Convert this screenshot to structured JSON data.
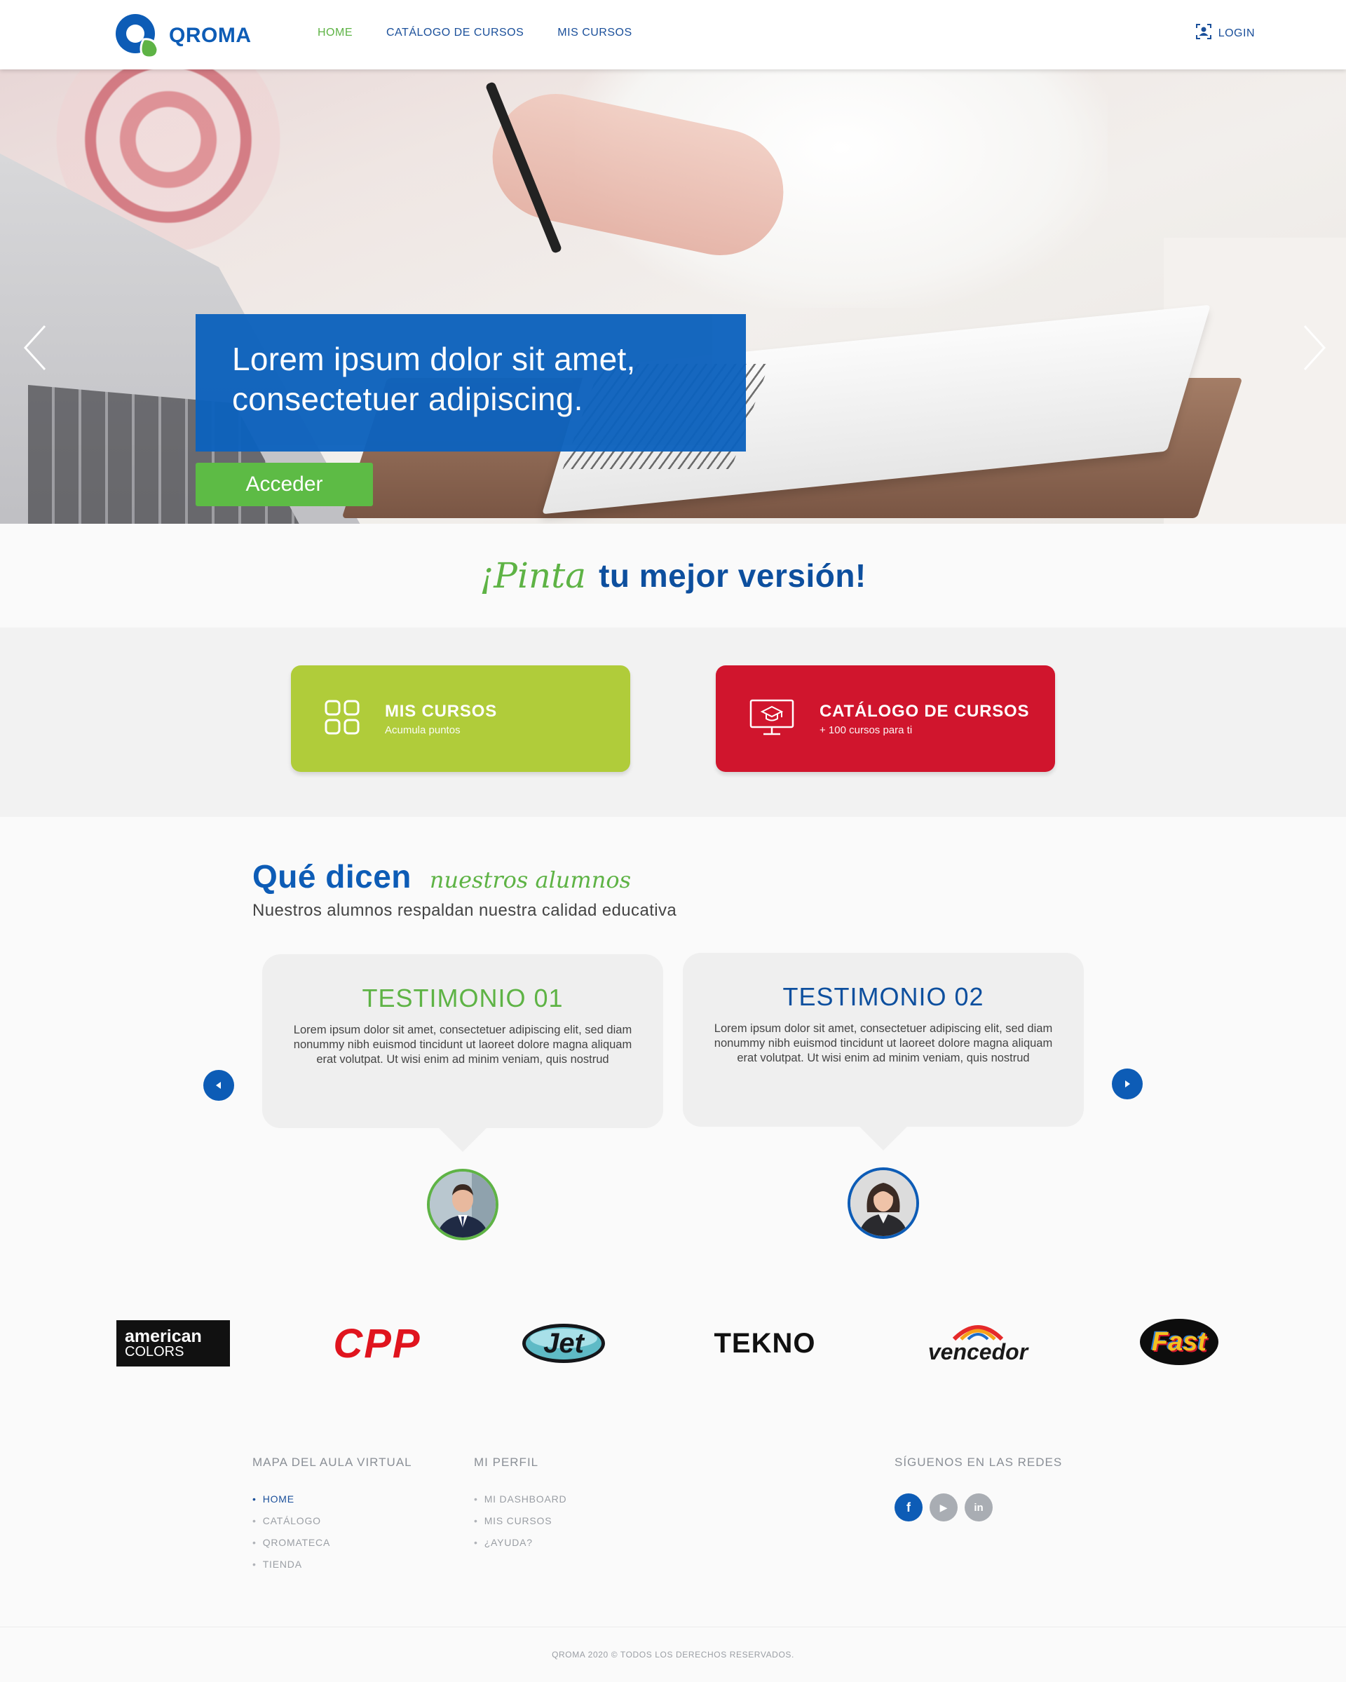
{
  "header": {
    "logo_text": "QROMA",
    "nav": [
      {
        "label": "HOME",
        "active": true
      },
      {
        "label": "CATÁLOGO DE CURSOS",
        "active": false
      },
      {
        "label": "MIS CURSOS",
        "active": false
      }
    ],
    "login_label": "LOGIN",
    "colors": {
      "brand_blue": "#0d5cb6",
      "brand_green": "#5eb345"
    }
  },
  "hero": {
    "headline_line1": "Lorem ipsum dolor sit amet,",
    "headline_line2": "consectetuer adipiscing.",
    "button_label": "Acceder",
    "icons": [
      "chevron-left-icon",
      "chevron-right-icon"
    ]
  },
  "tagline": {
    "script": "¡Pinta",
    "rest": "tu mejor versión!"
  },
  "cards": [
    {
      "title": "MIS CURSOS",
      "subtitle": "Acumula puntos",
      "icon": "grid-icon",
      "color": "#b0cc3a"
    },
    {
      "title": "CATÁLOGO DE CURSOS",
      "subtitle": "+ 100 cursos para ti",
      "icon": "monitor-graduation-icon",
      "color": "#d0152d"
    }
  ],
  "testimonials": {
    "title_big": "Qué dicen",
    "title_script": "nuestros alumnos",
    "subtitle": "Nuestros alumnos respaldan nuestra calidad educativa",
    "items": [
      {
        "title": "TESTIMONIO 01",
        "text": "Lorem ipsum dolor sit amet, consectetuer adipiscing elit, sed diam nonummy nibh euismod tincidunt ut laoreet dolore magna aliquam erat volutpat. Ut wisi enim ad minim veniam, quis nostrud"
      },
      {
        "title": "TESTIMONIO 02",
        "text": "Lorem ipsum dolor sit amet, consectetuer adipiscing elit, sed diam nonummy nibh euismod tincidunt ut laoreet dolore magna aliquam erat volutpat. Ut wisi enim ad minim veniam, quis nostrud"
      }
    ]
  },
  "brands": {
    "american_line1": "american",
    "american_line2": "COLORS",
    "cpp": "CPP",
    "jet": "Jet",
    "tekno": "TEKNO",
    "vencedor": "vencedor",
    "fast": "Fast"
  },
  "footer": {
    "col1": {
      "heading": "MAPA DEL AULA VIRTUAL",
      "items": [
        "HOME",
        "CATÁLOGO",
        "QROMATECA",
        "TIENDA"
      ]
    },
    "col2": {
      "heading": "MI PERFIL",
      "items": [
        "MI DASHBOARD",
        "MIS CURSOS",
        "¿AYUDA?"
      ]
    },
    "col3": {
      "heading": "SÍGUENOS EN LAS REDES",
      "socials": [
        {
          "icon": "facebook-icon",
          "glyph": "f",
          "color": "#0d5cb6"
        },
        {
          "icon": "youtube-icon",
          "glyph": "▶",
          "color": "#a9adb3"
        },
        {
          "icon": "linkedin-icon",
          "glyph": "in",
          "color": "#a9adb3"
        }
      ]
    },
    "copyright": "QROMA 2020 © TODOS LOS DERECHOS RESERVADOS."
  }
}
